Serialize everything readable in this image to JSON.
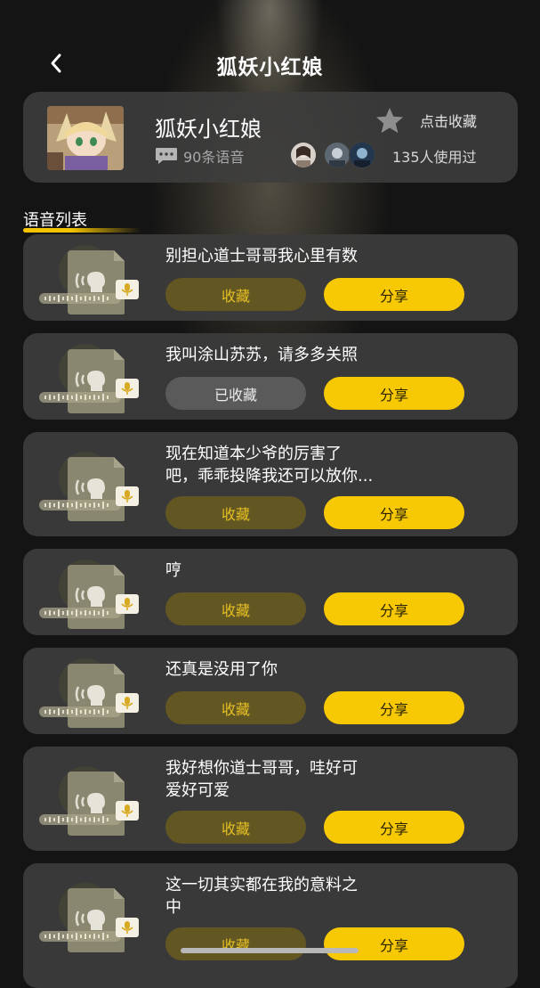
{
  "header": {
    "title": "狐妖小红娘"
  },
  "profile": {
    "name": "狐妖小红娘",
    "voice_count": "90条语音",
    "used_count": "135人使用过",
    "favorite_label": "点击收藏"
  },
  "section": {
    "title": "语音列表"
  },
  "voices": [
    {
      "line1": "别担心道士哥哥我心里有数",
      "line2": "",
      "fav_label": "收藏",
      "share_label": "分享",
      "favorited": false
    },
    {
      "line1": "我叫涂山苏苏，请多多关照",
      "line2": "",
      "fav_label": "已收藏",
      "share_label": "分享",
      "favorited": true
    },
    {
      "line1": "现在知道本少爷的厉害了",
      "line2": "吧，乖乖投降我还可以放你...",
      "fav_label": "收藏",
      "share_label": "分享",
      "favorited": false
    },
    {
      "line1": "哼",
      "line2": "",
      "fav_label": "收藏",
      "share_label": "分享",
      "favorited": false
    },
    {
      "line1": "还真是没用了你",
      "line2": "",
      "fav_label": "收藏",
      "share_label": "分享",
      "favorited": false
    },
    {
      "line1": "我好想你道士哥哥，哇好可",
      "line2": "爱好可爱",
      "fav_label": "收藏",
      "share_label": "分享",
      "favorited": false
    },
    {
      "line1": "这一切其实都在我的意料之",
      "line2": "中",
      "fav_label": "收藏",
      "share_label": "分享",
      "favorited": false
    }
  ],
  "colors": {
    "background": "#141414",
    "card": "#3c3c3c",
    "accent_yellow": "#f7c905",
    "fav_button": "#625623",
    "fav_button_text": "#e6c023",
    "favorited_button": "#5a5a5a"
  },
  "icons": {
    "back": "chevron-left-icon",
    "favorite": "star-icon",
    "voice_count": "message-icon",
    "voice_thumb": "voice-file-icon",
    "mic_badge": "microphone-icon"
  }
}
